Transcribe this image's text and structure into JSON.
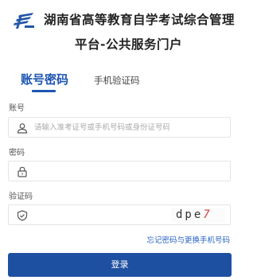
{
  "header": {
    "title_line1": "湖南省高等教育自学考试综合管理",
    "title_line2": "平台-公共服务门户",
    "logo_icon": "hunan-exam-logo-icon"
  },
  "tabs": [
    {
      "label": "账号密码",
      "active": true
    },
    {
      "label": "手机验证码",
      "active": false
    }
  ],
  "form": {
    "account": {
      "label": "账号",
      "placeholder": "请输入准考证号或手机号码或身份证号码",
      "value": "",
      "icon": "user-icon"
    },
    "password": {
      "label": "密码",
      "placeholder": "",
      "value": "",
      "icon": "lock-icon"
    },
    "captcha": {
      "label": "验证码",
      "placeholder": "",
      "value": "",
      "icon": "shield-icon",
      "image_text": "dpe",
      "image_text_last": "7"
    }
  },
  "forgot_link": "忘记密码与更换手机号码",
  "login_button": "登录",
  "colors": {
    "primary": "#1e50a2",
    "link": "#2b64c4",
    "active_tab": "#1e55b3"
  }
}
